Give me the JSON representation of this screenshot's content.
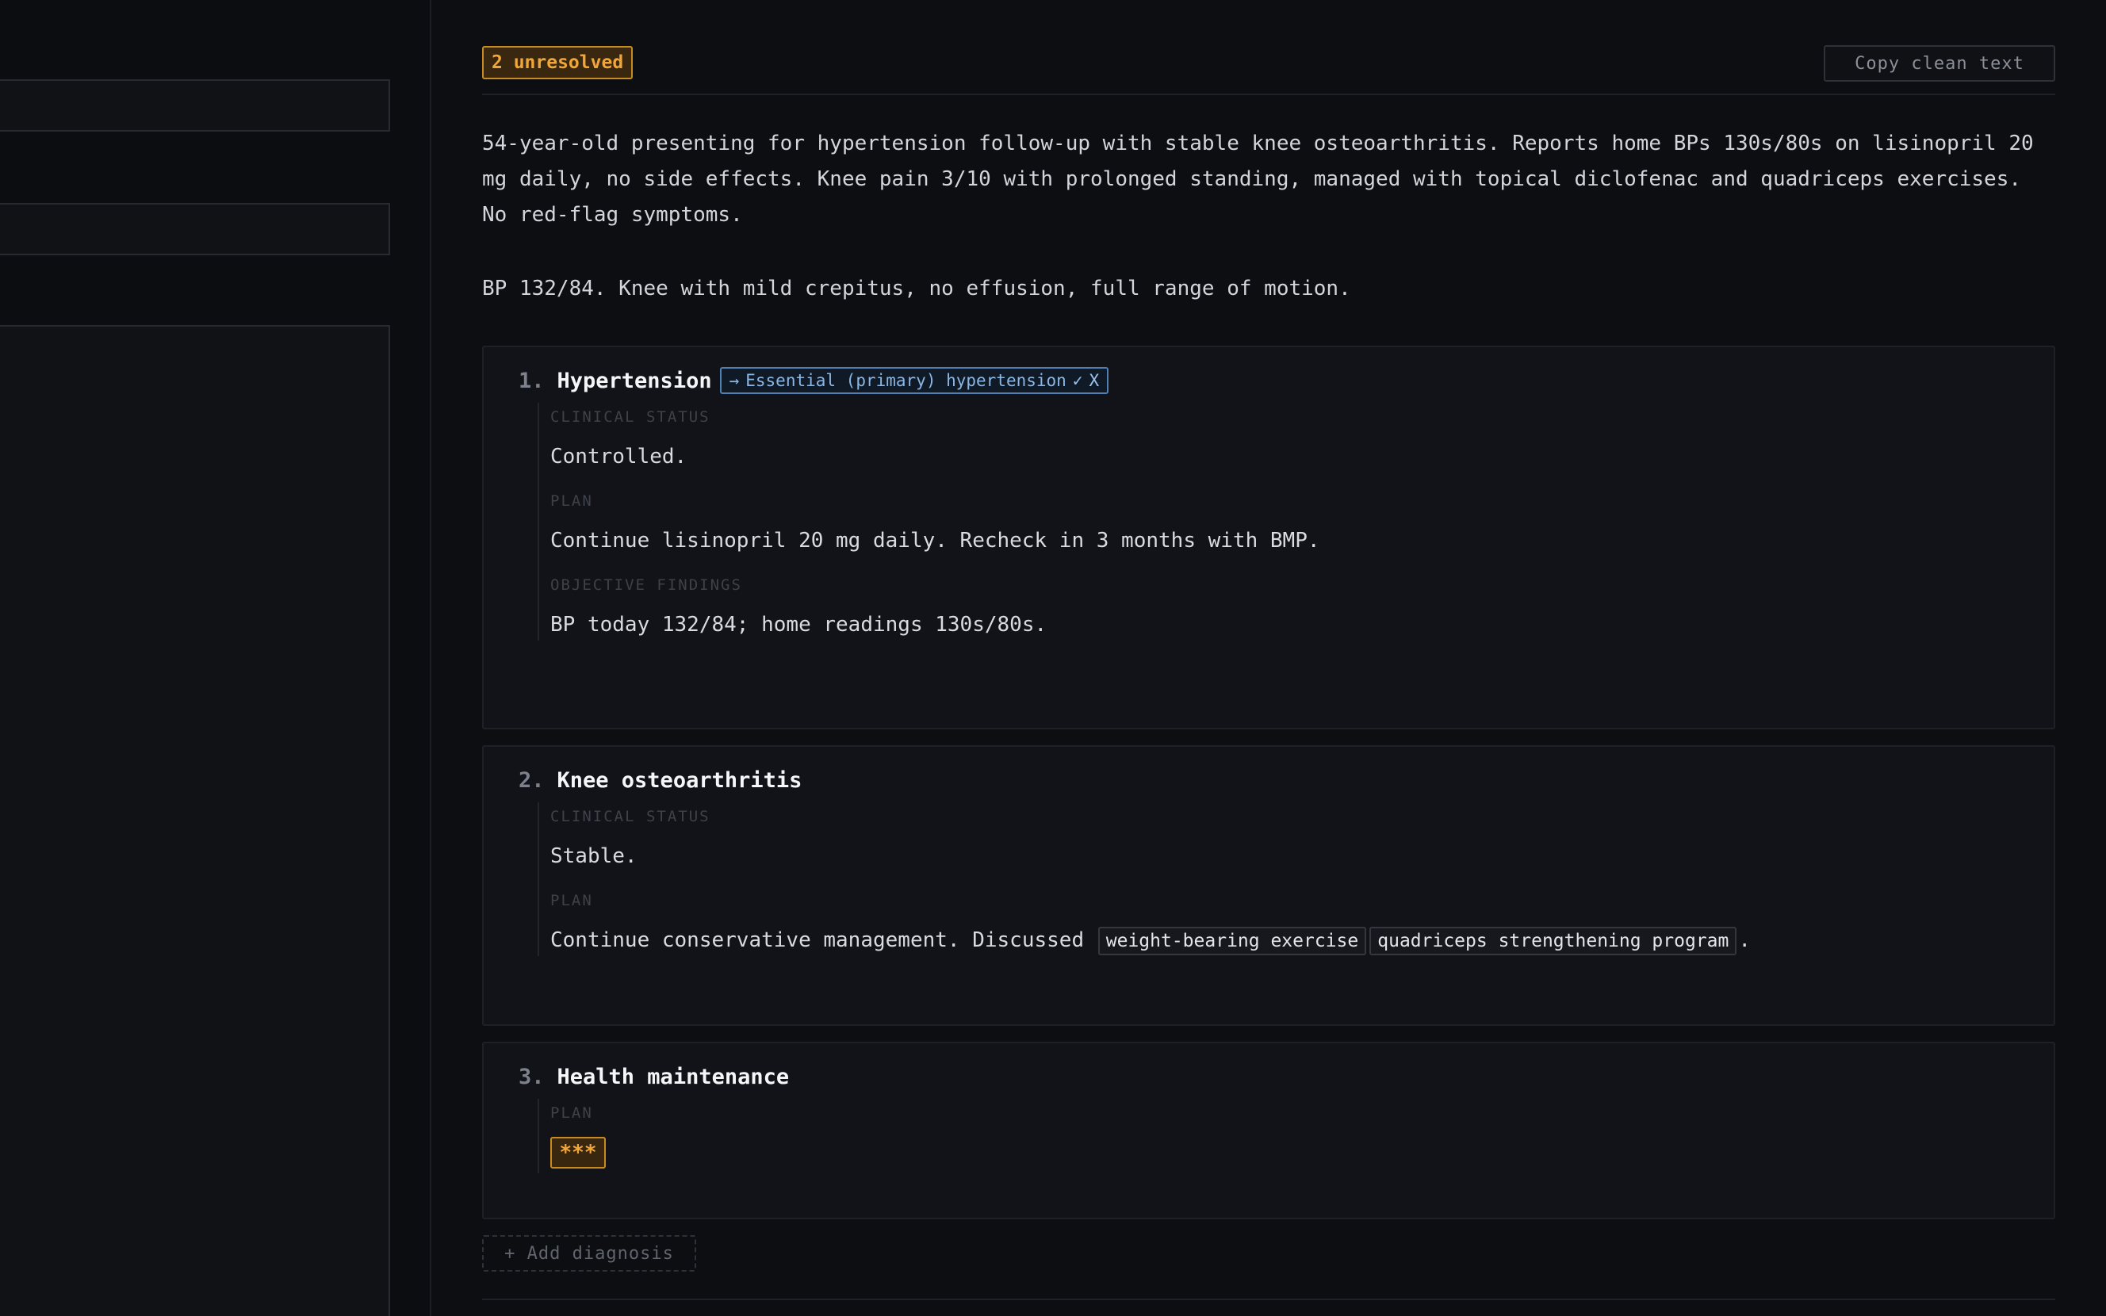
{
  "toolbar": {
    "unresolved_badge": "2 unresolved",
    "copy_button": "Copy clean text"
  },
  "note": {
    "paragraph_1": "54-year-old presenting for hypertension follow-up with stable knee osteoarthritis. Reports home BPs 130s/80s on lisinopril 20 mg daily, no side effects. Knee pain 3/10 with prolonged standing, managed with topical diclofenac and quadriceps exercises. No red-flag symptoms.",
    "paragraph_2": "BP 132/84. Knee with mild crepitus, no effusion, full range of motion."
  },
  "diagnoses": [
    {
      "number": "1.",
      "title": "Hypertension",
      "code_chip": {
        "arrow": "→",
        "label": "Essential (primary) hypertension",
        "accept": "✓",
        "reject": "X"
      },
      "sections": [
        {
          "label": "CLINICAL STATUS",
          "text": "Controlled."
        },
        {
          "label": "PLAN",
          "text": "Continue lisinopril 20 mg daily. Recheck in 3 months with BMP."
        },
        {
          "label": "OBJECTIVE FINDINGS",
          "text": "BP today 132/84; home readings 130s/80s."
        }
      ]
    },
    {
      "number": "2.",
      "title": "Knee osteoarthritis",
      "sections": [
        {
          "label": "CLINICAL STATUS",
          "text": "Stable."
        },
        {
          "label": "PLAN",
          "text_prefix": "Continue conservative management. Discussed",
          "pills": [
            "weight-bearing exercise",
            "quadriceps strengthening program"
          ],
          "text_suffix": "."
        }
      ]
    },
    {
      "number": "3.",
      "title": "Health maintenance",
      "sections": [
        {
          "label": "PLAN",
          "redacted_placeholder": "***"
        }
      ]
    }
  ],
  "add_diagnosis_button": "+ Add diagnosis",
  "colors": {
    "background": "#0c0e12",
    "warning_accent": "#f0a63a",
    "code_chip_accent": "#8cb6e3"
  }
}
